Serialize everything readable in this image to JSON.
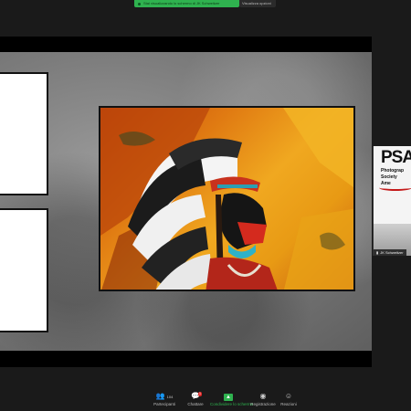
{
  "banner": {
    "share_text": "Stai visualizzando lo schermo di JK Schweitzer",
    "view_options": "Visualizza opzioni"
  },
  "slide": {
    "logo_main": "PSA",
    "logo_lines": [
      "Photograp",
      "Society",
      "Ame"
    ]
  },
  "participant": {
    "name": "JK Schweitzer"
  },
  "toolbar": {
    "participants_label": "Partecipanti",
    "participants_count": "104",
    "chat_label": "Chattare",
    "chat_badge": "1",
    "share_label": "Condividere lo schermo",
    "record_label": "Registrazione",
    "reactions_label": "Reazioni"
  },
  "colors": {
    "accent_green": "#2fb24f",
    "alert_red": "#e02828",
    "psa_red": "#c41a1a"
  }
}
